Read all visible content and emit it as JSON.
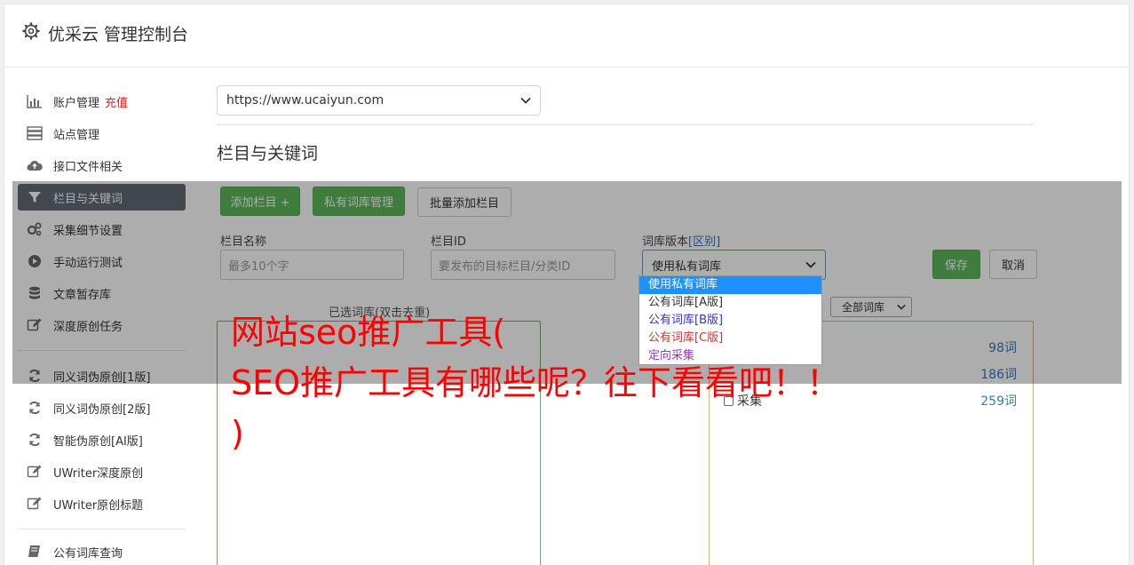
{
  "header": {
    "title": "优采云 管理控制台"
  },
  "sidebar": {
    "items": [
      {
        "label": "账户管理",
        "badge": "充值",
        "icon": "bar-chart-icon"
      },
      {
        "label": "站点管理",
        "icon": "server-icon"
      },
      {
        "label": "接口文件相关",
        "icon": "cloud-upload-icon"
      },
      {
        "label": "栏目与关键词",
        "icon": "filter-icon",
        "active": true
      },
      {
        "label": "采集细节设置",
        "icon": "cogs-icon"
      },
      {
        "label": "手动运行测试",
        "icon": "play-circle-icon"
      },
      {
        "label": "文章暂存库",
        "icon": "database-icon"
      },
      {
        "label": "深度原创任务",
        "icon": "edit-icon"
      },
      {
        "label": "同义词伪原创[1版]",
        "icon": "refresh-icon"
      },
      {
        "label": "同义词伪原创[2版]",
        "icon": "refresh-icon"
      },
      {
        "label": "智能伪原创[AI版]",
        "icon": "refresh-icon"
      },
      {
        "label": "UWriter深度原创",
        "icon": "edit-icon"
      },
      {
        "label": "UWriter原创标题",
        "icon": "edit-icon"
      },
      {
        "label": "公有词库查询",
        "icon": "book-icon"
      }
    ]
  },
  "main": {
    "site_select": "https://www.ucaiyun.com",
    "section_title": "栏目与关键词",
    "buttons": {
      "add_column": "添加栏目 +",
      "private_lib": "私有词库管理",
      "batch_add": "批量添加栏目",
      "save": "保存",
      "cancel": "取消"
    },
    "fields": {
      "column_name": {
        "label": "栏目名称",
        "placeholder": "最多10个字"
      },
      "column_id": {
        "label": "栏目ID",
        "placeholder": "要发布的目标栏目/分类ID"
      },
      "lib_version": {
        "label": "词库版本",
        "link": "[区别]",
        "value": "使用私有词库"
      }
    },
    "dropdown_options": [
      {
        "label": "使用私有词库",
        "color": "#ffffff"
      },
      {
        "label": "公有词库[A版]",
        "color": "#333333"
      },
      {
        "label": "公有词库[B版]",
        "color": "#3333cc"
      },
      {
        "label": "公有词库[C版]",
        "color": "#cc3333"
      },
      {
        "label": "定向采集",
        "color": "#9933cc"
      }
    ],
    "selected_caption": "已选词库(双击去重)",
    "filter_select": "全部词库",
    "libraries": [
      {
        "name": "",
        "count": "98词"
      },
      {
        "name": "",
        "count": "186词"
      },
      {
        "name": "采集",
        "count": "259词"
      }
    ]
  },
  "promo": {
    "line1": "网站seo推广工具(",
    "line2": "SEO推广工具有哪些呢？往下看看吧！！",
    "line3": ")"
  },
  "colors": {
    "accent": "#5cb85c",
    "active_nav": "#646b77",
    "promo": "#ff0000"
  }
}
